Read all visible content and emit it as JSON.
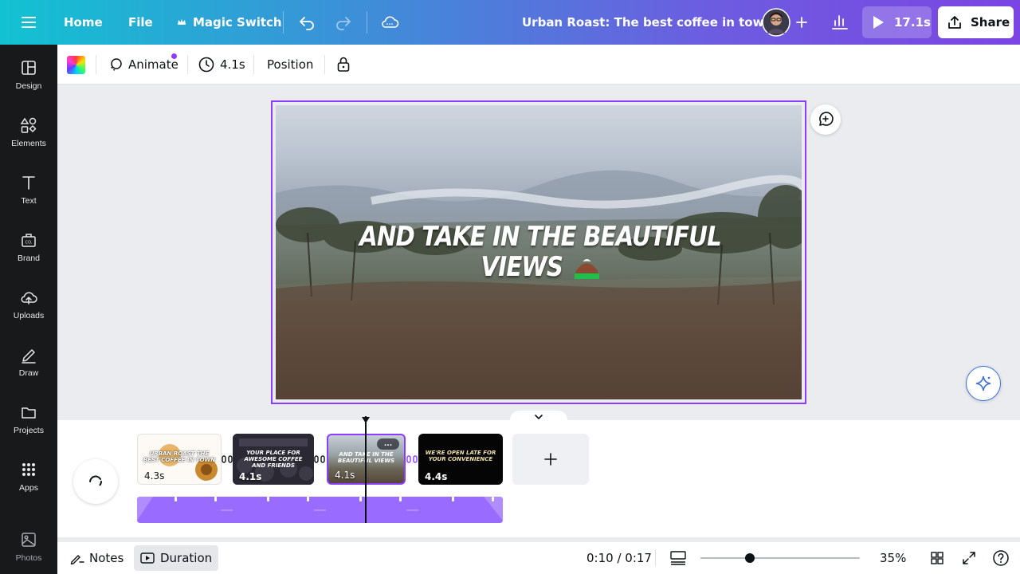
{
  "topbar": {
    "home": "Home",
    "file": "File",
    "magic_switch": "Magic Switch",
    "design_title": "Urban Roast: The best coffee in town",
    "play_duration": "17.1s",
    "share": "Share"
  },
  "sidebar": {
    "items": [
      {
        "label": "Design",
        "icon": "layout-icon"
      },
      {
        "label": "Elements",
        "icon": "shapes-icon"
      },
      {
        "label": "Text",
        "icon": "text-icon"
      },
      {
        "label": "Brand",
        "icon": "brand-icon"
      },
      {
        "label": "Uploads",
        "icon": "cloud-upload-icon"
      },
      {
        "label": "Draw",
        "icon": "pen-icon"
      },
      {
        "label": "Projects",
        "icon": "folder-icon"
      },
      {
        "label": "Apps",
        "icon": "grid-icon"
      },
      {
        "label": "Photos",
        "icon": "image-icon"
      }
    ]
  },
  "toolbar": {
    "animate": "Animate",
    "duration": "4.1s",
    "position": "Position"
  },
  "canvas": {
    "caption_line1": "AND TAKE IN THE BEAUTIFUL",
    "caption_line2": "VIEWS"
  },
  "timeline": {
    "clips": [
      {
        "duration": "4.3s",
        "title": "URBAN ROAST THE BEST COFFEE IN TOWN"
      },
      {
        "duration": "4.1s",
        "title": "YOUR PLACE FOR AWESOME COFFEE AND FRIENDS"
      },
      {
        "duration": "4.1s",
        "title": "AND TAKE IN THE BEAUTIFUL VIEWS"
      },
      {
        "duration": "4.4s",
        "title": "WE'RE OPEN LATE FOR YOUR CONVENIENCE"
      }
    ],
    "more_label": "..."
  },
  "bottombar": {
    "notes": "Notes",
    "duration": "Duration",
    "time": "0:10 / 0:17",
    "zoom": "35%",
    "zoom_level": 0.35
  },
  "colors": {
    "accent": "#8b3dff",
    "sidebar_bg": "#18191b",
    "gradient_start": "#12c2d2",
    "gradient_end": "#7b45e3"
  }
}
